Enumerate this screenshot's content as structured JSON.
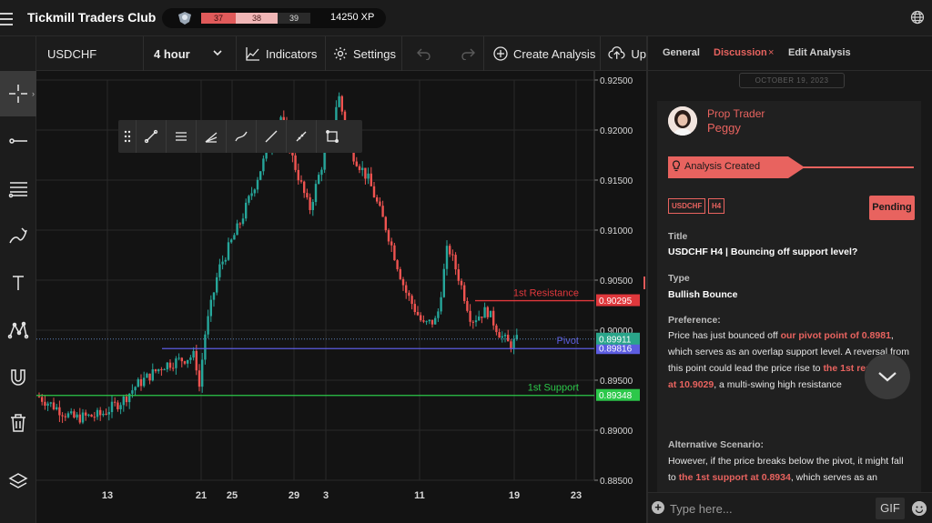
{
  "app": {
    "title": "Tickmill Traders Club",
    "xp": {
      "seg1": "37",
      "seg2": "38",
      "seg3": "39",
      "total": "14250 XP"
    }
  },
  "toolbar": {
    "symbol": "USDCHF",
    "interval": "4 hour",
    "indicators": "Indicators",
    "settings": "Settings",
    "create_analysis": "Create Analysis",
    "upload": "Up"
  },
  "chart": {
    "price_axis": [
      "0.92500",
      "0.92000",
      "0.91500",
      "0.91000",
      "0.90500",
      "0.90000",
      "0.89500",
      "0.89000",
      "0.88500"
    ],
    "price_range": [
      0.885,
      0.925
    ],
    "time_axis": [
      "13",
      "21",
      "25",
      "29",
      "3",
      "11",
      "19",
      "23"
    ],
    "levels": [
      {
        "label": "1st Resistance",
        "price": 0.90295,
        "price_label": "0.90295",
        "color": "#e0383c"
      },
      {
        "label": "Pivot",
        "price": 0.89816,
        "price_label": "0.89816",
        "color": "#5c5ce0"
      },
      {
        "label": "1st Support",
        "price": 0.89348,
        "price_label": "0.89348",
        "color": "#2cc84a"
      }
    ],
    "current_price": {
      "price": 0.89911,
      "label": "0.89911",
      "color": "#2aa58a"
    },
    "colors": {
      "up": "#26a69a",
      "down": "#ef5350",
      "grid": "#2a2a2a"
    }
  },
  "panel": {
    "tabs": {
      "general": "General",
      "discussion": "Discussion",
      "close": "×",
      "edit": "Edit Analysis"
    },
    "date": "OCTOBER 19, 2023",
    "author_role": "Prop Trader",
    "author_name": "Peggy",
    "banner": "Analysis Created",
    "tags": [
      "USDCHF",
      "H4"
    ],
    "status": "Pending",
    "title_label": "Title",
    "title_value": "USDCHF H4 | Bouncing off support level?",
    "type_label": "Type",
    "type_value": "Bullish Bounce",
    "preference_label": "Preference:",
    "preference": {
      "p1": "Price has just bounced off ",
      "h1": "our pivot point of 0.8981",
      "p2": ", which serves as an overlap support level.  A reversal from this point could lead the price rise to ",
      "h2": "the 1st resistance at 10.9029",
      "p3": ", a multi-swing high resistance"
    },
    "alt_label": "Alternative Scenario:",
    "alternative": {
      "p1": "However, if the price breaks below the pivot, it might fall to ",
      "h1": "the 1st support at 0.8934",
      "p2": ", which serves as an"
    },
    "comment_placeholder": "Type here...",
    "gif": "GIF"
  }
}
